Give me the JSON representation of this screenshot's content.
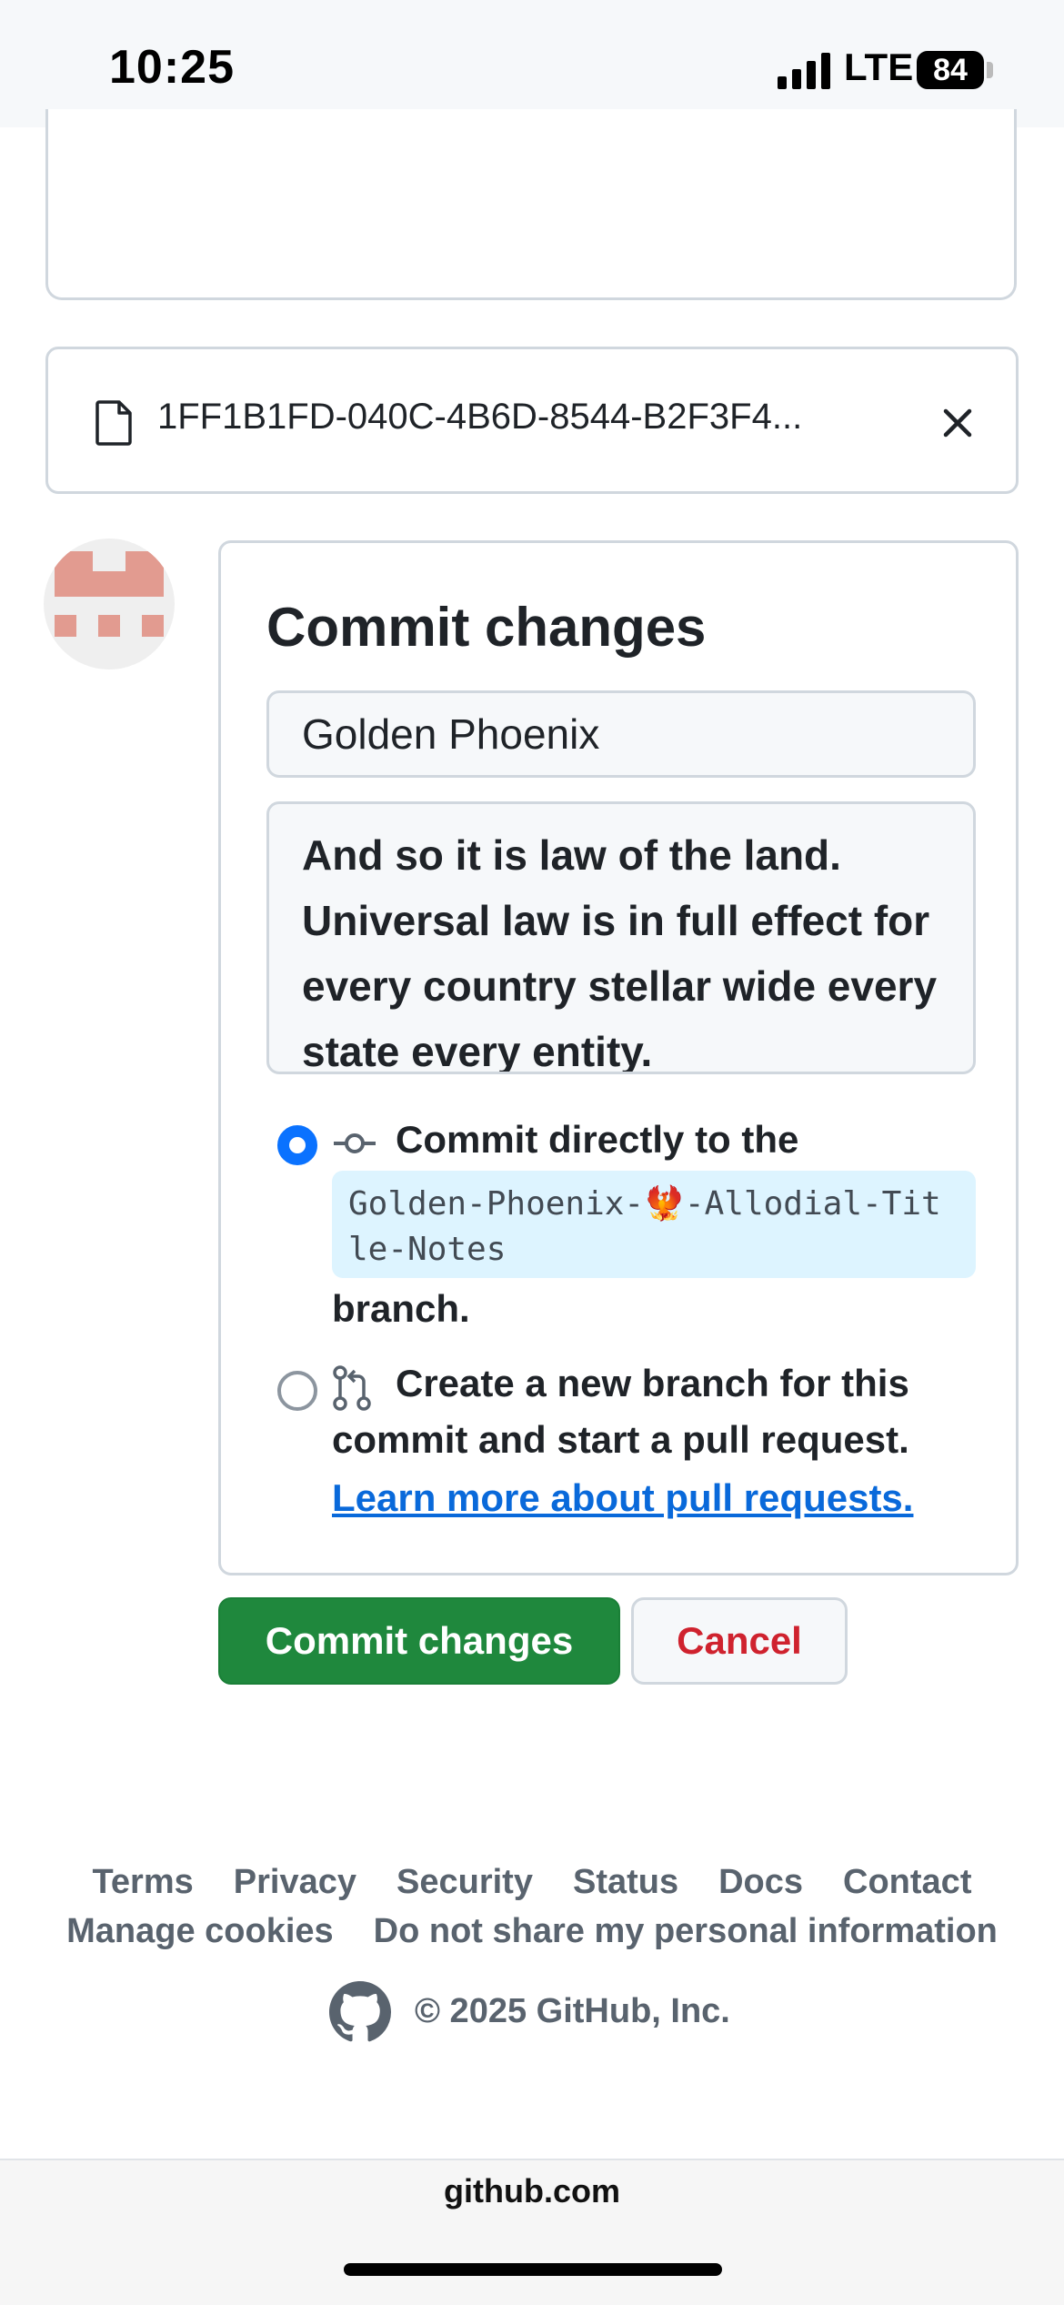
{
  "status_bar": {
    "time": "10:25",
    "network": "LTE",
    "battery": "84"
  },
  "file": {
    "name": "1FF1B1FD-040C-4B6D-8544-B2F3F4...",
    "icon": "file-icon",
    "remove_icon": "close-icon"
  },
  "commit": {
    "title": "Commit changes",
    "summary": "Golden Phoenix",
    "description": "And so it is law of the land. Universal law is in full effect for every country stellar wide every state every entity.",
    "option_direct": {
      "text": "Commit directly to the",
      "branch": "Golden-Phoenix-🐦‍🔥-Allodial-Title-Notes",
      "after": "branch.",
      "selected": true
    },
    "option_new_branch": {
      "prefix": "Create a ",
      "strong": "new branch",
      "suffix": " for this",
      "line2": "commit and start a pull request.",
      "link": "Learn more about pull requests.",
      "selected": false
    },
    "submit_label": "Commit changes",
    "cancel_label": "Cancel"
  },
  "footer": {
    "links": [
      "Terms",
      "Privacy",
      "Security",
      "Status",
      "Docs",
      "Contact"
    ],
    "links2": [
      "Manage cookies",
      "Do not share my personal information"
    ],
    "copyright": "© 2025 GitHub, Inc."
  },
  "browser": {
    "url": "github.com"
  },
  "colors": {
    "primary_green": "#1f883d",
    "cancel_red": "#cf222e",
    "link_blue": "#0969da",
    "radio_blue": "#0a72ff",
    "branch_bg": "#ddf4ff"
  }
}
